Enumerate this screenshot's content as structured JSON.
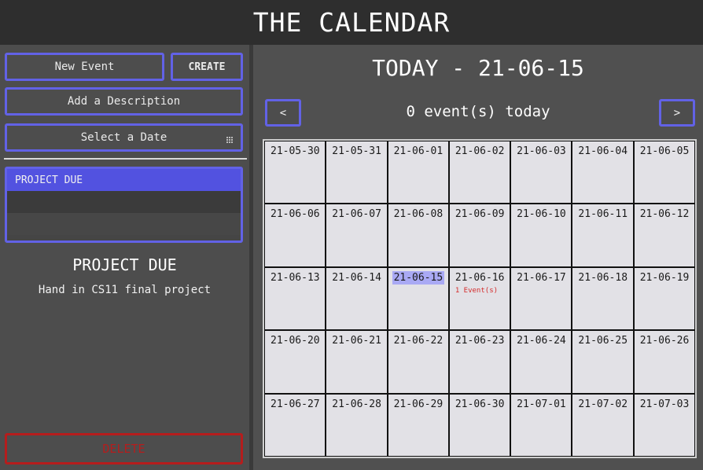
{
  "app": {
    "title": "THE CALENDAR"
  },
  "form": {
    "event_name_value": "New Event",
    "create_label": "CREATE",
    "description_placeholder": "Add a Description",
    "date_placeholder": "Select a Date"
  },
  "events_list": [
    {
      "label": "PROJECT DUE",
      "selected": true
    },
    {
      "label": ""
    },
    {
      "label": ""
    }
  ],
  "selected_event": {
    "title": "PROJECT DUE",
    "description": "Hand in CS11 final project"
  },
  "delete_label": "DELETE",
  "calendar": {
    "today_heading": "TODAY - 21-06-15",
    "events_today": "0 event(s) today",
    "prev_label": "<",
    "next_label": ">",
    "today_date": "21-06-15",
    "days": [
      {
        "date": "21-05-30"
      },
      {
        "date": "21-05-31"
      },
      {
        "date": "21-06-01"
      },
      {
        "date": "21-06-02"
      },
      {
        "date": "21-06-03"
      },
      {
        "date": "21-06-04"
      },
      {
        "date": "21-06-05"
      },
      {
        "date": "21-06-06"
      },
      {
        "date": "21-06-07"
      },
      {
        "date": "21-06-08"
      },
      {
        "date": "21-06-09"
      },
      {
        "date": "21-06-10"
      },
      {
        "date": "21-06-11"
      },
      {
        "date": "21-06-12"
      },
      {
        "date": "21-06-13"
      },
      {
        "date": "21-06-14"
      },
      {
        "date": "21-06-15"
      },
      {
        "date": "21-06-16",
        "events": "1 Event(s)"
      },
      {
        "date": "21-06-17"
      },
      {
        "date": "21-06-18"
      },
      {
        "date": "21-06-19"
      },
      {
        "date": "21-06-20"
      },
      {
        "date": "21-06-21"
      },
      {
        "date": "21-06-22"
      },
      {
        "date": "21-06-23"
      },
      {
        "date": "21-06-24"
      },
      {
        "date": "21-06-25"
      },
      {
        "date": "21-06-26"
      },
      {
        "date": "21-06-27"
      },
      {
        "date": "21-06-28"
      },
      {
        "date": "21-06-29"
      },
      {
        "date": "21-06-30"
      },
      {
        "date": "21-07-01"
      },
      {
        "date": "21-07-02"
      },
      {
        "date": "21-07-03"
      }
    ]
  },
  "colors": {
    "accent": "#6262e6",
    "selected_row": "#5252e0",
    "today_highlight": "#a9a9f4",
    "danger": "#b51d1d",
    "event_count": "#d42b2b"
  },
  "icons": {
    "date_picker": "calendar-grid-icon"
  }
}
